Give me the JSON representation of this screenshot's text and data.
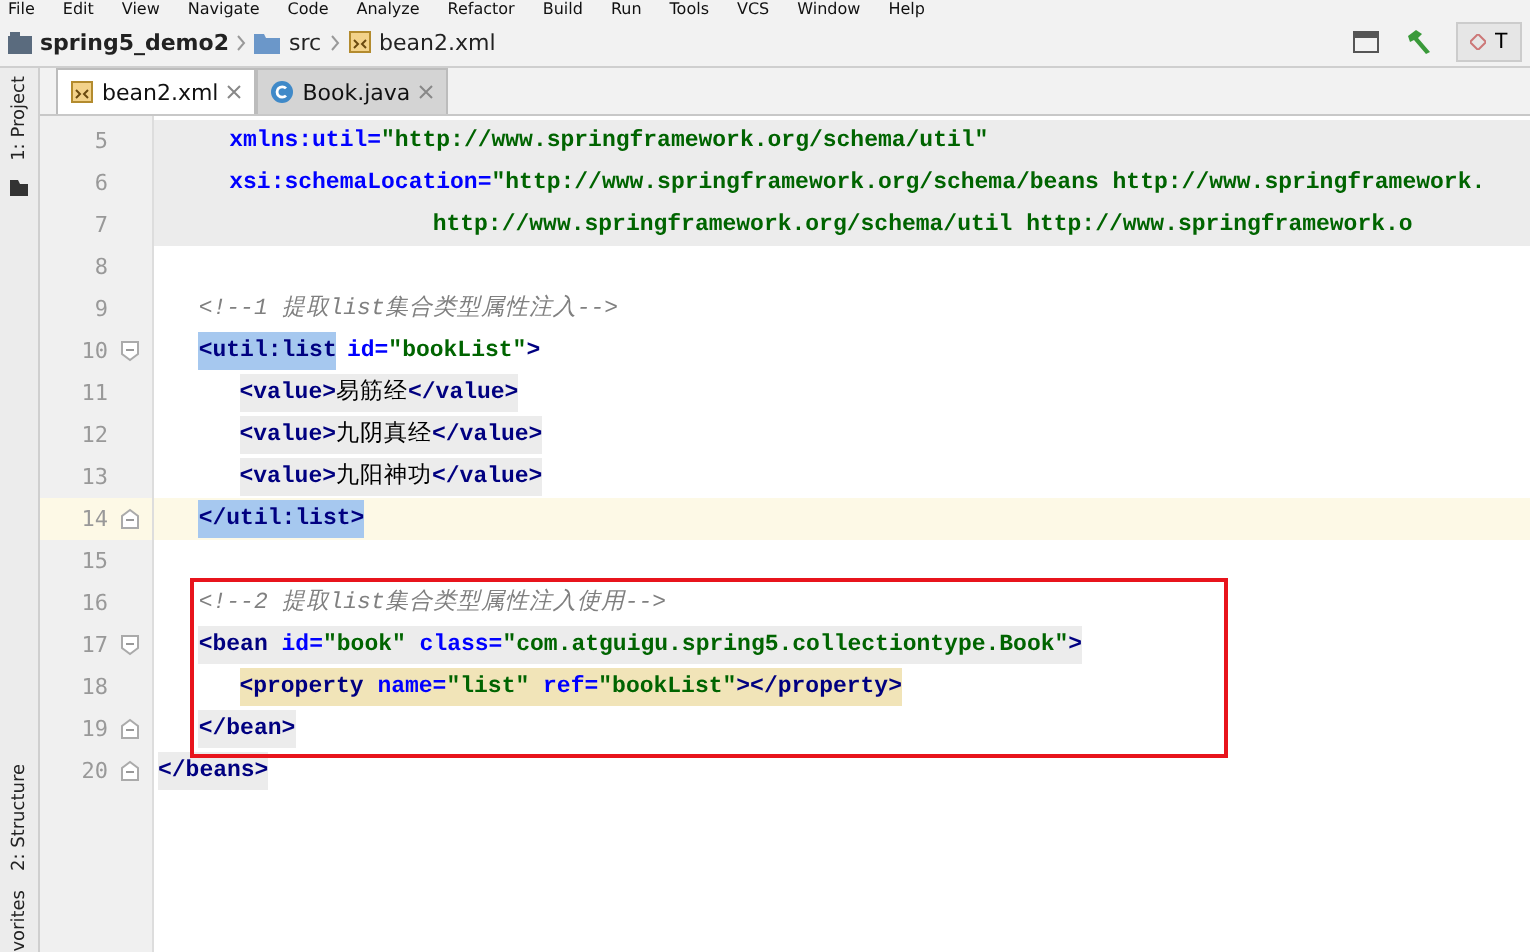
{
  "menu": [
    "File",
    "Edit",
    "View",
    "Navigate",
    "Code",
    "Analyze",
    "Refactor",
    "Build",
    "Run",
    "Tools",
    "VCS",
    "Window",
    "Help"
  ],
  "breadcrumbs": [
    {
      "label": "spring5_demo2",
      "kind": "project"
    },
    {
      "label": "src",
      "kind": "folder"
    },
    {
      "label": "bean2.xml",
      "kind": "xml"
    }
  ],
  "toolbar": {
    "right_button": "T"
  },
  "tool_strip": {
    "top": [
      "1: Project"
    ],
    "bottom": [
      "2: Structure",
      "vorites"
    ]
  },
  "tabs": [
    {
      "label": "bean2.xml",
      "kind": "xml",
      "selected": true
    },
    {
      "label": "Book.java",
      "kind": "java",
      "selected": false
    }
  ],
  "lines": [
    {
      "number": "5",
      "shaded": true,
      "current": false,
      "fold_start": false,
      "fold_end": false,
      "tokens": [
        {
          "kind": "attr",
          "text": "       xmlns:util="
        },
        {
          "kind": "val",
          "text": "\"http://www.springframework.org/schema/util\""
        }
      ]
    },
    {
      "number": "6",
      "shaded": true,
      "current": false,
      "fold_start": false,
      "fold_end": false,
      "tokens": [
        {
          "kind": "attr",
          "text": "       xsi:schemaLocation="
        },
        {
          "kind": "val",
          "text": "\"http://www.springframework.org/schema/beans http://www.springframework."
        }
      ]
    },
    {
      "number": "7",
      "shaded": true,
      "current": false,
      "fold_start": false,
      "fold_end": false,
      "tokens": [
        {
          "kind": "val",
          "text": "                           http://www.springframework.org/schema/util http://www.springframework.o"
        }
      ]
    },
    {
      "number": "8",
      "shaded": false,
      "current": false,
      "fold_start": false,
      "fold_end": false
    },
    {
      "number": "9",
      "shaded": false,
      "current": false,
      "fold_start": false,
      "fold_end": false,
      "tokens": [
        {
          "kind": "comment",
          "text": "    <!--1 提取list集合类型属性注入-->"
        }
      ]
    },
    {
      "number": "10",
      "shaded": false,
      "current": false,
      "fold_start": true,
      "fold_end": false,
      "tokens": [
        {
          "kind": "match",
          "text": "    <util:list"
        },
        {
          "kind": "attr",
          "text": " id="
        },
        {
          "kind": "val",
          "text": "\"bookList\""
        },
        {
          "kind": "tag",
          "text": ">"
        }
      ]
    },
    {
      "number": "11",
      "shaded": false,
      "current": false,
      "fold_start": false,
      "fold_end": false,
      "tokens": [
        {
          "kind": "tag-shade",
          "text": "        <value>"
        },
        {
          "kind": "text-shade",
          "text": "易筋经"
        },
        {
          "kind": "tag-shade",
          "text": "</value>"
        }
      ]
    },
    {
      "number": "12",
      "shaded": false,
      "current": false,
      "fold_start": false,
      "fold_end": false,
      "tokens": [
        {
          "kind": "tag-shade",
          "text": "        <value>"
        },
        {
          "kind": "text-shade",
          "text": "九阴真经"
        },
        {
          "kind": "tag-shade",
          "text": "</value>"
        }
      ]
    },
    {
      "number": "13",
      "shaded": false,
      "current": false,
      "fold_start": false,
      "fold_end": false,
      "tokens": [
        {
          "kind": "tag-shade",
          "text": "        <value>"
        },
        {
          "kind": "text-shade",
          "text": "九阳神功"
        },
        {
          "kind": "tag-shade",
          "text": "</value>"
        }
      ]
    },
    {
      "number": "14",
      "shaded": false,
      "current": true,
      "fold_start": false,
      "fold_end": true,
      "tokens": [
        {
          "kind": "match",
          "text": "    </util:list>"
        }
      ]
    },
    {
      "number": "15",
      "shaded": false,
      "current": false,
      "fold_start": false,
      "fold_end": false
    },
    {
      "number": "16",
      "boxed": true,
      "shaded": false,
      "current": false,
      "fold_start": false,
      "fold_end": false,
      "tokens": [
        {
          "kind": "comment",
          "text": "    <!--2 提取list集合类型属性注入使用-->"
        }
      ]
    },
    {
      "number": "17",
      "boxed": true,
      "shaded": false,
      "current": false,
      "fold_start": true,
      "fold_end": false,
      "tokens": [
        {
          "kind": "tag-shade",
          "text": "    <bean "
        },
        {
          "kind": "attr-shade",
          "text": "id="
        },
        {
          "kind": "val-shade",
          "text": "\"book\" "
        },
        {
          "kind": "attr-shade",
          "text": "class="
        },
        {
          "kind": "val-shade",
          "text": "\"com.atguigu.spring5.collectiontype.Book\""
        },
        {
          "kind": "tag-shade",
          "text": ">"
        }
      ]
    },
    {
      "number": "18",
      "boxed": true,
      "shaded": false,
      "current": false,
      "fold_start": false,
      "fold_end": false,
      "tokens": [
        {
          "kind": "tag-tan",
          "text": "        <property "
        },
        {
          "kind": "attr-tan",
          "text": "name="
        },
        {
          "kind": "val-tan",
          "text": "\"list\" "
        },
        {
          "kind": "attr-tan",
          "text": "ref="
        },
        {
          "kind": "val-tan",
          "text": "\"bookList\""
        },
        {
          "kind": "tag-tan",
          "text": "></property>"
        }
      ]
    },
    {
      "number": "19",
      "boxed": true,
      "shaded": false,
      "current": false,
      "fold_start": false,
      "fold_end": true,
      "tokens": [
        {
          "kind": "tag-shade",
          "text": "    </bean>"
        }
      ]
    },
    {
      "number": "20",
      "shaded": false,
      "current": false,
      "fold_start": false,
      "fold_end": true,
      "tokens": [
        {
          "kind": "tag-shade",
          "text": "</beans>"
        }
      ]
    }
  ]
}
